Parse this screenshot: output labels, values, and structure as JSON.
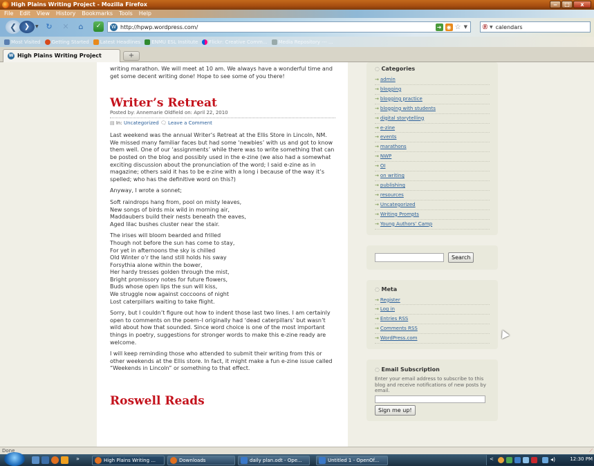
{
  "window": {
    "title": "High Plains Writing Project - Mozilla Firefox",
    "min_glyph": "‒",
    "max_glyph": "□",
    "close_glyph": "x"
  },
  "menu": [
    "File",
    "Edit",
    "View",
    "History",
    "Bookmarks",
    "Tools",
    "Help"
  ],
  "nav": {
    "url": "http://hpwp.wordpress.com/",
    "search_value": "calendars",
    "search_engine_icon": "reverso-icon"
  },
  "bookmarks": [
    {
      "label": "Most Visited",
      "icon": "bookmarks-folder-icon",
      "color": "#5a7fb0"
    },
    {
      "label": "Getting Started",
      "icon": "firefox-icon",
      "color": "#d74a1b"
    },
    {
      "label": "Latest Headlines",
      "icon": "rss-icon",
      "color": "#e88a1c"
    },
    {
      "label": "ENMU ESL Institute",
      "icon": "site-icon",
      "color": "#2f8a2f"
    },
    {
      "label": "Flickr: Creative Comm...",
      "icon": "flickr-icon",
      "color": "#e0236b"
    },
    {
      "label": "Media Repository --- ...",
      "icon": "page-icon",
      "color": "#9aa"
    }
  ],
  "tab": {
    "label": "High Plains Writing Project",
    "new_tab_glyph": "+"
  },
  "posts": {
    "intro_text": "writing marathon. We will meet at 10 am. We always have a wonderful time and get some decent writing done! Hope to see some of you there!",
    "title": "Writer’s Retreat",
    "meta": "Posted by: Annemarie Oldfield on: April 22, 2010",
    "in_label": "In:",
    "category": "Uncategorized",
    "comment_link": "Leave a Comment",
    "paragraphs": [
      "Last weekend was the annual Writer’s Retreat at the Ellis Store in Lincoln, NM. We missed many familiar faces but had some ‘newbies’ with us and got to know them well. One of our ‘assignments’ while there was to write something that can be posted on the blog and possibly used in the e-zine (we also had a somewhat exciting discussion about the pronunciation of the word; I said e-zine as in magazine; others said it has to be e-zine with a long i because of the way it’s spelled; who has the definitive word on this?)",
      "Anyway, I wrote a sonnet;"
    ],
    "poem_stanza1": "Soft raindrops hang from, pool on misty leaves,\nNew songs of birds mix wild in morning air,\nMaddaubers build their nests beneath the eaves,\nAged lilac bushes cluster near the stair.",
    "poem_stanza2": "The irises will bloom bearded and frilled\nThough not before the sun has come to stay,\nFor yet in afternoons the sky is chilled\nOld Winter o’r the land still holds his sway\nForsythia alone within the bower,\nHer hardy tresses golden through the mist,\nBright promissory notes for future flowers,\nBuds whose open lips the sun will kiss,\nWe struggle now against coccoons of night\nLost caterpillars waiting to take flight.",
    "closing": [
      "Sorry, but I couldn’t figure out how to indent those last two lines. I am certainly open to comments on the poem–I originally had ‘dead caterpillars’ but wasn’t wild about how that sounded. Since word choice is one of the most important things in poetry, suggestions for stronger words to make this e-zine ready are welcome.",
      "I will keep reminding those who attended to submit their writing from this or other weekends at the Ellis store. In fact, it might make a fun e-zine issue called “Weekends in Lincoln” or something to that effect."
    ],
    "next_title": "Roswell Reads"
  },
  "sidebar": {
    "categories_title": "Categories",
    "categories": [
      "admin",
      "blogging",
      "blogging practice",
      "blogging with students",
      "digital storytelling",
      "e-zine",
      "events",
      "marathons",
      "NWP",
      "OI",
      "on writing",
      "publishing",
      "resources",
      "Uncategorized",
      "Writing Prompts",
      "Young Authors’ Camp"
    ],
    "search_button": "Search",
    "meta_title": "Meta",
    "meta_links": [
      "Register",
      "Log in",
      "Entries RSS",
      "Comments RSS",
      "WordPress.com"
    ],
    "email_title": "Email Subscription",
    "email_text": "Enter your email address to subscribe to this blog and receive notifications of new posts by email.",
    "signup_button": "Sign me up!"
  },
  "status": {
    "text": "Done"
  },
  "taskbar": {
    "items": [
      {
        "label": "High Plains Writing ...",
        "color": "#e07020",
        "active": true
      },
      {
        "label": "Downloads",
        "color": "#e07020"
      },
      {
        "label": "daily plan.odt - Ope...",
        "color": "#3a78c8"
      },
      {
        "label": "Untitled 1 - OpenOf...",
        "color": "#3a78c8"
      }
    ],
    "clock": "12:30 PM",
    "overflow": "»"
  }
}
